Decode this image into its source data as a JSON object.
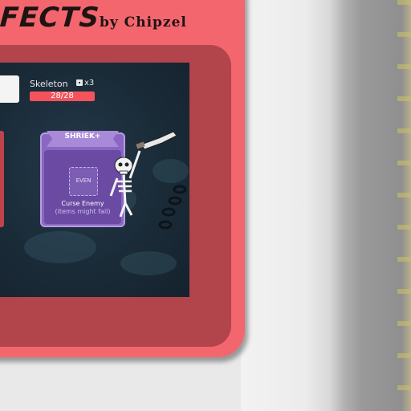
{
  "header": {
    "title": "FECTS",
    "byline": "by Chipzel"
  },
  "enemy": {
    "name": "Skeleton",
    "dice": "x3",
    "hp": "28/28",
    "icon": "skeleton-icon"
  },
  "card": {
    "title": "SHRIEK+",
    "slot_label": "EVEN",
    "name": "Curse Enemy",
    "note": "(items might fail)",
    "color": "#8a67c2"
  },
  "colors": {
    "frame": "#f4666d",
    "frame_inner": "#b2444c",
    "screen": "#1a2b38",
    "hp_bar": "#f4535c"
  }
}
